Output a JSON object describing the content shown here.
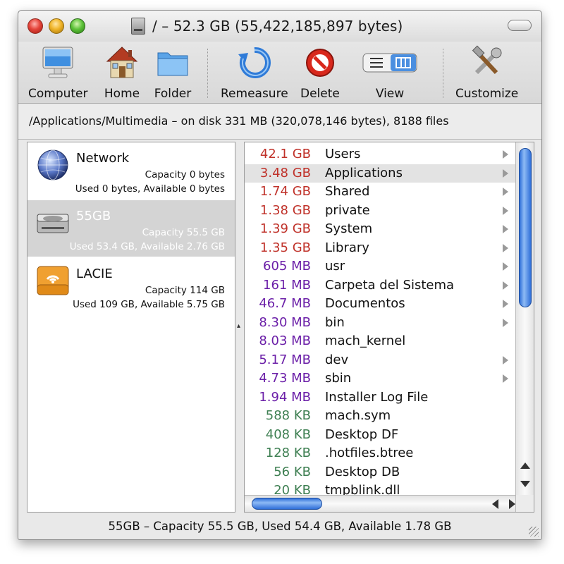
{
  "window": {
    "title": "/ – 52.3 GB (55,422,185,897 bytes)"
  },
  "toolbar": {
    "computer_label": "Computer",
    "home_label": "Home",
    "folder_label": "Folder",
    "remeasure_label": "Remeasure",
    "delete_label": "Delete",
    "view_label": "View",
    "customize_label": "Customize"
  },
  "path": {
    "text": "/Applications/Multimedia – on disk 331 MB (320,078,146 bytes), 8188 files"
  },
  "volumes": [
    {
      "name": "Network",
      "capacity": "Capacity 0 bytes",
      "usage": "Used 0 bytes, Available 0 bytes",
      "icon": "network-globe-icon"
    },
    {
      "name": "55GB",
      "capacity": "Capacity 55.5 GB",
      "usage": "Used 53.4 GB, Available 2.76 GB",
      "icon": "hard-disk-icon"
    },
    {
      "name": "LACIE",
      "capacity": "Capacity 114 GB",
      "usage": "Used 109 GB, Available 5.75 GB",
      "icon": "firewire-disk-icon"
    }
  ],
  "files": [
    {
      "size": "42.1 GB",
      "name": "Users",
      "unit": "gb",
      "folder": true
    },
    {
      "size": "3.48 GB",
      "name": "Applications",
      "unit": "gb",
      "folder": true
    },
    {
      "size": "1.74 GB",
      "name": "Shared",
      "unit": "gb",
      "folder": true
    },
    {
      "size": "1.38 GB",
      "name": "private",
      "unit": "gb",
      "folder": true
    },
    {
      "size": "1.39 GB",
      "name": "System",
      "unit": "gb",
      "folder": true
    },
    {
      "size": "1.35 GB",
      "name": "Library",
      "unit": "gb",
      "folder": true
    },
    {
      "size": "605 MB",
      "name": "usr",
      "unit": "mb",
      "folder": true
    },
    {
      "size": "161 MB",
      "name": "Carpeta del Sistema",
      "unit": "mb",
      "folder": true
    },
    {
      "size": "46.7 MB",
      "name": "Documentos",
      "unit": "mb",
      "folder": true
    },
    {
      "size": "8.30 MB",
      "name": "bin",
      "unit": "mb",
      "folder": true
    },
    {
      "size": "8.03 MB",
      "name": "mach_kernel",
      "unit": "mb",
      "folder": false
    },
    {
      "size": "5.17 MB",
      "name": "dev",
      "unit": "mb",
      "folder": true
    },
    {
      "size": "4.73 MB",
      "name": "sbin",
      "unit": "mb",
      "folder": true
    },
    {
      "size": "1.94 MB",
      "name": "Installer Log File",
      "unit": "mb",
      "folder": false
    },
    {
      "size": "588 KB",
      "name": "mach.sym",
      "unit": "kb",
      "folder": false
    },
    {
      "size": "408 KB",
      "name": "Desktop DF",
      "unit": "kb",
      "folder": false
    },
    {
      "size": "128 KB",
      "name": ".hotfiles.btree",
      "unit": "kb",
      "folder": false
    },
    {
      "size": "56 KB",
      "name": "Desktop DB",
      "unit": "kb",
      "folder": false
    },
    {
      "size": "20 KB",
      "name": "tmpblink.dll",
      "unit": "kb",
      "folder": false
    }
  ],
  "colors": {
    "gb": "#c0322a",
    "mb": "#6b1fa8",
    "kb": "#3e7f52",
    "selected_row": "#e3e3e3",
    "selected_volume": "#d4d4d4",
    "scroll_thumb": "#2f6fd8"
  },
  "status": {
    "text": "55GB – Capacity 55.5 GB, Used 54.4 GB, Available 1.78 GB"
  }
}
